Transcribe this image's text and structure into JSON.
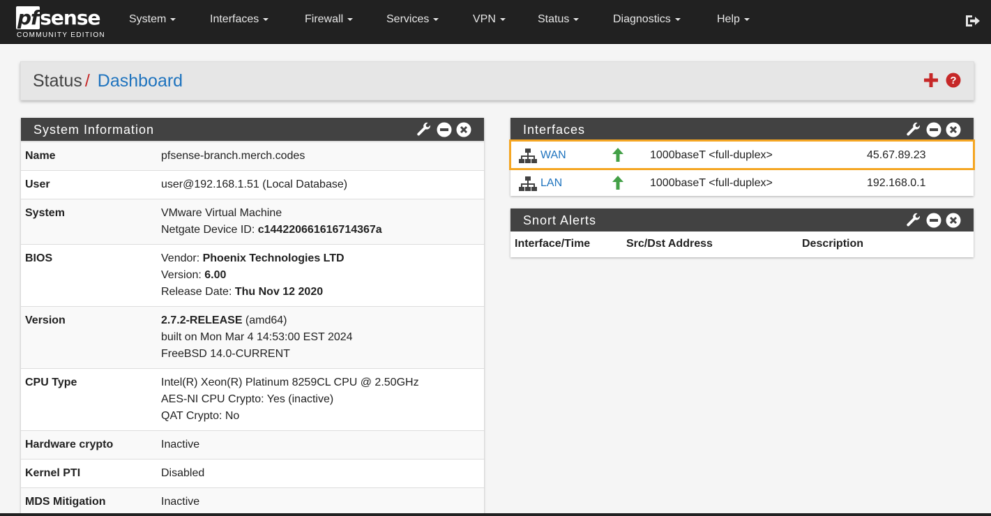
{
  "brand": {
    "logo_text": "pfsense",
    "sub": "COMMUNITY EDITION"
  },
  "nav": {
    "items": [
      "System",
      "Interfaces",
      "Firewall",
      "Services",
      "VPN",
      "Status",
      "Diagnostics",
      "Help"
    ]
  },
  "breadcrumb": {
    "section": "Status",
    "separator": "/",
    "page": "Dashboard"
  },
  "system_info": {
    "title": "System Information",
    "rows": [
      {
        "label": "Name",
        "lines": [
          "pfsense-branch.merch.codes"
        ]
      },
      {
        "label": "User",
        "lines": [
          "user@192.168.1.51 (Local Database)"
        ]
      },
      {
        "label": "System",
        "lines": [
          "VMware Virtual Machine",
          "Netgate Device ID: ",
          "c144220661616714367a"
        ]
      },
      {
        "label": "BIOS",
        "lines": [
          "Vendor: ",
          "Phoenix Technologies LTD",
          "Version: ",
          "6.00",
          "Release Date: ",
          "Thu Nov 12 2020"
        ]
      },
      {
        "label": "Version",
        "lines": [
          "2.7.2-RELEASE",
          " (amd64)",
          "built on Mon Mar 4 14:53:00 EST 2024",
          "FreeBSD 14.0-CURRENT"
        ]
      },
      {
        "label": "CPU Type",
        "lines": [
          "Intel(R) Xeon(R) Platinum 8259CL CPU @ 2.50GHz",
          "AES-NI CPU Crypto: Yes (inactive)",
          "QAT Crypto: No"
        ]
      },
      {
        "label": "Hardware crypto",
        "lines": [
          "Inactive"
        ]
      },
      {
        "label": "Kernel PTI",
        "lines": [
          "Disabled"
        ]
      },
      {
        "label": "MDS Mitigation",
        "lines": [
          "Inactive"
        ]
      }
    ]
  },
  "interfaces": {
    "title": "Interfaces",
    "rows": [
      {
        "name": "WAN",
        "media": "1000baseT <full-duplex>",
        "ip": "45.67.89.23",
        "status": "up"
      },
      {
        "name": "LAN",
        "media": "1000baseT <full-duplex>",
        "ip": "192.168.0.1",
        "status": "up"
      }
    ]
  },
  "snort": {
    "title": "Snort Alerts",
    "columns": [
      "Interface/Time",
      "Src/Dst Address",
      "Description"
    ]
  },
  "colors": {
    "navbar": "#212121",
    "accent_red": "#c62828",
    "link_blue": "#1e73be",
    "up_green": "#43a047",
    "highlight": "#f5a623"
  }
}
